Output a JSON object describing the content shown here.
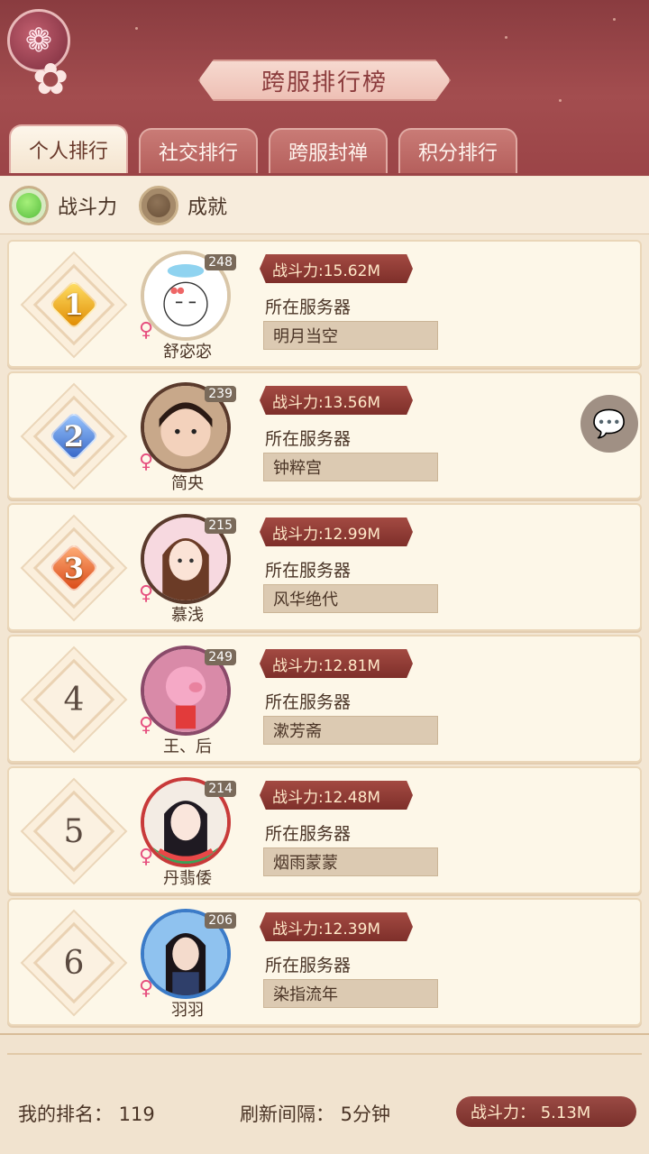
{
  "header": {
    "title": "跨服排行榜",
    "tabs": [
      {
        "label": "个人排行",
        "active": true
      },
      {
        "label": "社交排行",
        "active": false
      },
      {
        "label": "跨服封禅",
        "active": false
      },
      {
        "label": "积分排行",
        "active": false
      }
    ]
  },
  "filters": [
    {
      "label": "战斗力",
      "selected": true
    },
    {
      "label": "成就",
      "selected": false
    }
  ],
  "rows": [
    {
      "rank": "1",
      "medal": "gold",
      "level": "248",
      "name": "舒宓宓",
      "power": "战斗力:15.62M",
      "server_label": "所在服务器",
      "server": "明月当空"
    },
    {
      "rank": "2",
      "medal": "blue",
      "level": "239",
      "name": "简央",
      "power": "战斗力:13.56M",
      "server_label": "所在服务器",
      "server": "钟粹宫"
    },
    {
      "rank": "3",
      "medal": "orange",
      "level": "215",
      "name": "慕浅",
      "power": "战斗力:12.99M",
      "server_label": "所在服务器",
      "server": "风华绝代"
    },
    {
      "rank": "4",
      "medal": "none",
      "level": "249",
      "name": "王、后",
      "power": "战斗力:12.81M",
      "server_label": "所在服务器",
      "server": "漱芳斋"
    },
    {
      "rank": "5",
      "medal": "none",
      "level": "214",
      "name": "丹翡倭",
      "power": "战斗力:12.48M",
      "server_label": "所在服务器",
      "server": "烟雨蒙蒙"
    },
    {
      "rank": "6",
      "medal": "none",
      "level": "206",
      "name": "羽羽",
      "power": "战斗力:12.39M",
      "server_label": "所在服务器",
      "server": "染指流年"
    }
  ],
  "footer": {
    "my_rank": "我的排名：  119",
    "refresh": "刷新间隔：  5分钟",
    "my_power": "战斗力：  5.13M"
  },
  "icons": {
    "back": "back-flower-icon",
    "chat": "chat-bubble-icon",
    "gender": "female-icon"
  },
  "colors": {
    "header_bg": "#9b4447",
    "accent": "#7e2f2a",
    "row_bg": "#fdf7e8"
  }
}
